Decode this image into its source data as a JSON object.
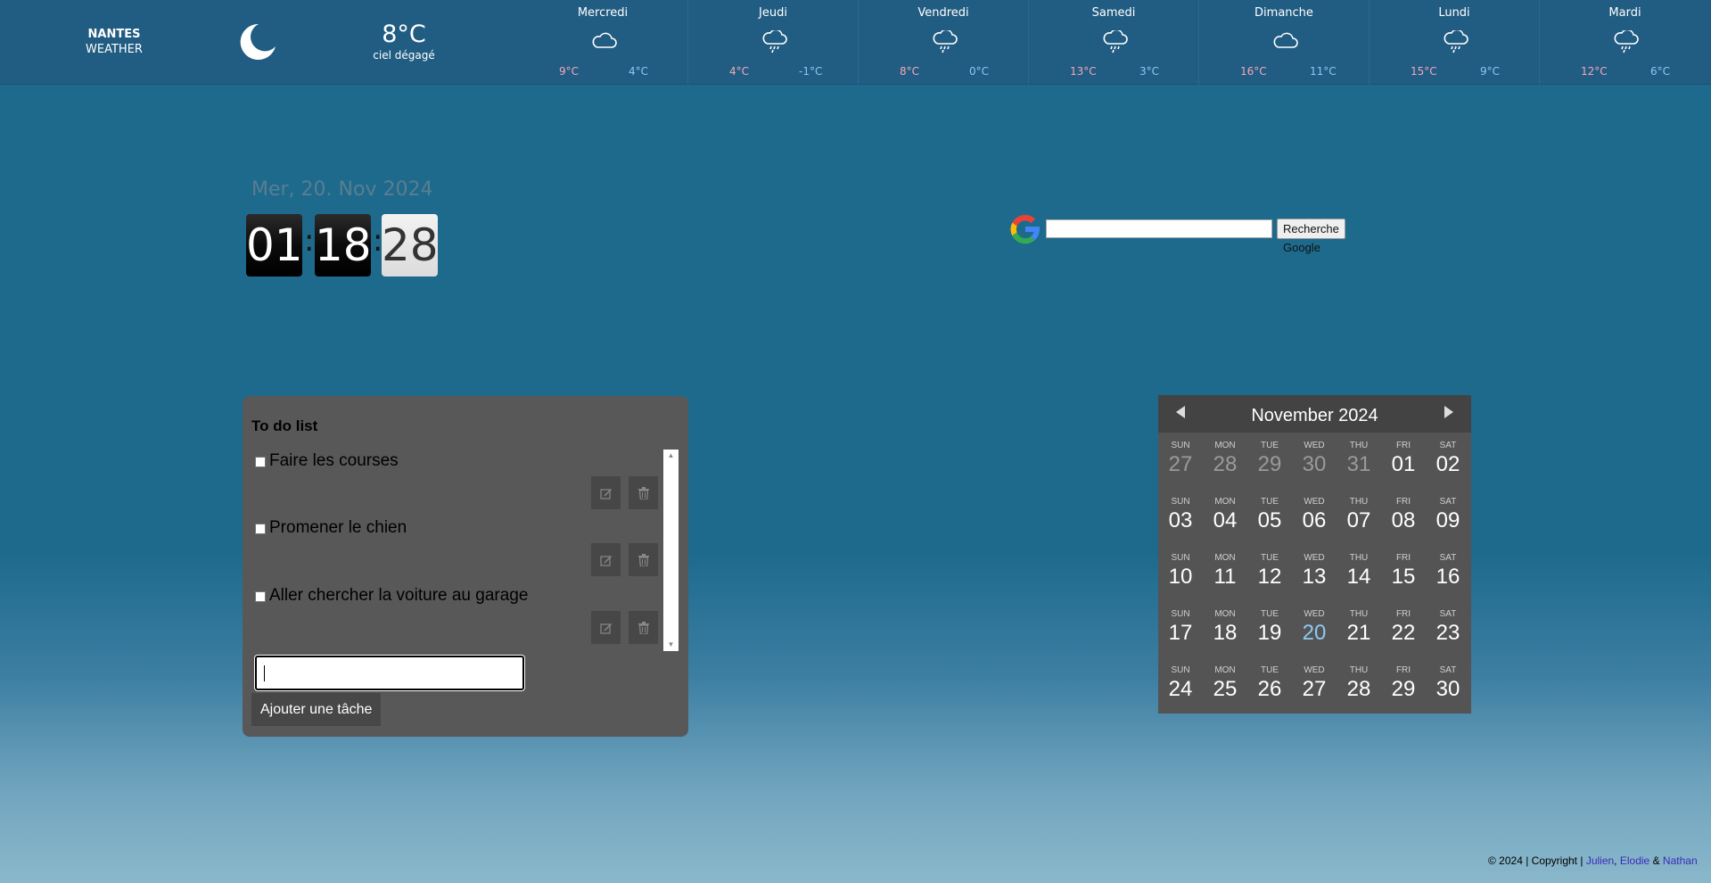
{
  "weather": {
    "city": "NANTES",
    "label": "WEATHER",
    "current_icon": "moon-icon",
    "current_temp": "8°C",
    "current_desc": "ciel dégagé",
    "forecast": [
      {
        "day": "Mercredi",
        "icon": "cloud-icon",
        "max": "9°C",
        "min": "4°C"
      },
      {
        "day": "Jeudi",
        "icon": "rain-cloud-icon",
        "max": "4°C",
        "min": "-1°C"
      },
      {
        "day": "Vendredi",
        "icon": "rain-cloud-icon",
        "max": "8°C",
        "min": "0°C"
      },
      {
        "day": "Samedi",
        "icon": "rain-cloud-icon",
        "max": "13°C",
        "min": "3°C"
      },
      {
        "day": "Dimanche",
        "icon": "cloud-icon",
        "max": "16°C",
        "min": "11°C"
      },
      {
        "day": "Lundi",
        "icon": "rain-cloud-icon",
        "max": "15°C",
        "min": "9°C"
      },
      {
        "day": "Mardi",
        "icon": "rain-cloud-icon",
        "max": "12°C",
        "min": "6°C"
      }
    ],
    "colors": {
      "max": "#f4a7b6",
      "min": "#8ec6f7"
    }
  },
  "clock": {
    "date": "Mer, 20. Nov 2024",
    "hours": "01",
    "minutes": "18",
    "seconds": "28",
    "separator": ":"
  },
  "search": {
    "logo_icon": "google-icon",
    "value": "",
    "button_label": "Recherche Google"
  },
  "todo": {
    "title": "To do list",
    "items": [
      {
        "text": "Faire les courses",
        "checked": false
      },
      {
        "text": "Promener le chien",
        "checked": false
      },
      {
        "text": "Aller chercher la voiture au garage",
        "checked": false
      }
    ],
    "edit_icon": "edit-icon",
    "delete_icon": "trash-icon",
    "input_value": "",
    "add_label": "Ajouter une tâche"
  },
  "calendar": {
    "title": "November 2024",
    "weekdays": [
      "SUN",
      "MON",
      "TUE",
      "WED",
      "THU",
      "FRI",
      "SAT"
    ],
    "weeks": [
      [
        "27",
        "28",
        "29",
        "30",
        "31",
        "01",
        "02"
      ],
      [
        "03",
        "04",
        "05",
        "06",
        "07",
        "08",
        "09"
      ],
      [
        "10",
        "11",
        "12",
        "13",
        "14",
        "15",
        "16"
      ],
      [
        "17",
        "18",
        "19",
        "20",
        "21",
        "22",
        "23"
      ],
      [
        "24",
        "25",
        "26",
        "27",
        "28",
        "29",
        "30"
      ]
    ],
    "other_month_days": [
      "27",
      "28",
      "29",
      "30",
      "31"
    ],
    "today": "20",
    "today_color": "#8ecaf0"
  },
  "footer": {
    "text": "© 2024 | Copyright |",
    "authors": [
      "Julien",
      "Elodie",
      "Nathan"
    ],
    "separator": ",",
    "and": "&"
  }
}
